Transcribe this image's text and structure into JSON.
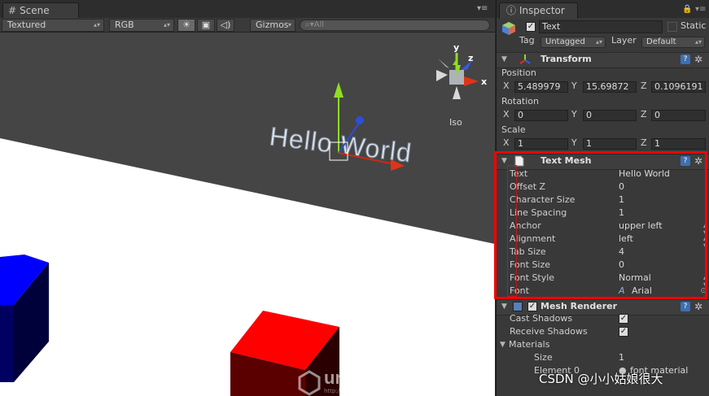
{
  "scene": {
    "tab_label": "Scene",
    "toolbar": {
      "render_mode": "Textured",
      "color_mode": "RGB",
      "gizmos_label": "Gizmos",
      "search_placeholder": "All"
    },
    "text_3d": "Hello World",
    "gizmo": {
      "axis_x": "x",
      "axis_y": "y",
      "axis_z": "z",
      "projection": "Iso"
    },
    "colors": {
      "plane": "#ffffff",
      "cube_blue": "#0000ff",
      "cube_red": "#ff0000",
      "background": "#454545"
    }
  },
  "inspector": {
    "tab_label": "Inspector",
    "object": {
      "name": "Text",
      "static_label": "Static",
      "tag_label": "Tag",
      "tag_value": "Untagged",
      "layer_label": "Layer",
      "layer_value": "Default"
    },
    "transform": {
      "title": "Transform",
      "position_label": "Position",
      "position": {
        "x": "5.489979",
        "y": "15.69872",
        "z": "0.1096191"
      },
      "rotation_label": "Rotation",
      "rotation": {
        "x": "0",
        "y": "0",
        "z": "0"
      },
      "scale_label": "Scale",
      "scale": {
        "x": "1",
        "y": "1",
        "z": "1"
      },
      "axis_x": "X",
      "axis_y": "Y",
      "axis_z": "Z"
    },
    "text_mesh": {
      "title": "Text Mesh",
      "properties": [
        {
          "label": "Text",
          "value": "Hello World"
        },
        {
          "label": "Offset Z",
          "value": "0"
        },
        {
          "label": "Character Size",
          "value": "1"
        },
        {
          "label": "Line Spacing",
          "value": "1"
        },
        {
          "label": "Anchor",
          "value": "upper left"
        },
        {
          "label": "Alignment",
          "value": "left"
        },
        {
          "label": "Tab Size",
          "value": "4"
        },
        {
          "label": "Font Size",
          "value": "0"
        },
        {
          "label": "Font Style",
          "value": "Normal"
        },
        {
          "label": "Font",
          "value": "Arial"
        }
      ]
    },
    "mesh_renderer": {
      "title": "Mesh Renderer",
      "cast_shadows_label": "Cast Shadows",
      "receive_shadows_label": "Receive Shadows",
      "materials_label": "Materials",
      "size_label": "Size",
      "size_value": "1",
      "element0_label": "Element 0",
      "element0_value": "font material"
    }
  },
  "watermark": {
    "unity_text": "unity",
    "unity_sub": "教程手册",
    "unity_url": "http://www.unitymanual.com",
    "csdn_text": "CSDN @小小姑娘很大"
  },
  "highlight_color": "#ff0000"
}
